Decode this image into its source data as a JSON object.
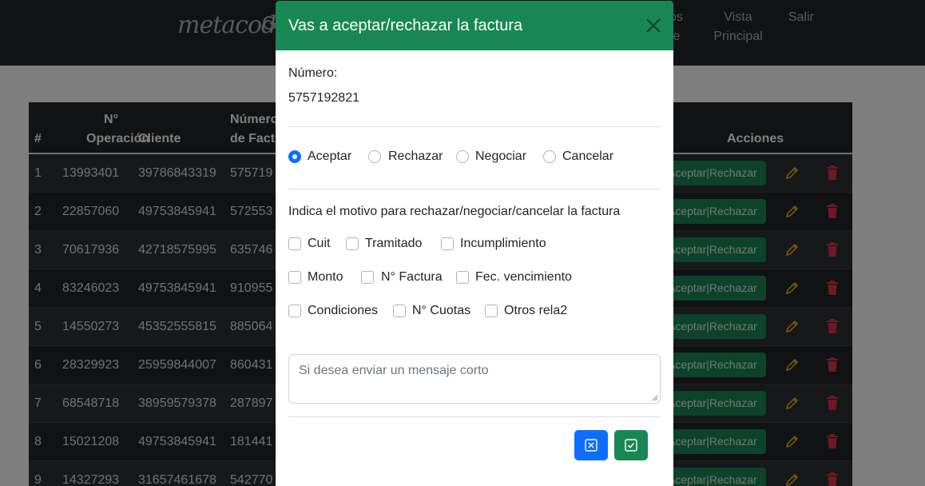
{
  "navbar": {
    "logo": "metacodo",
    "brand_rest": "G",
    "links": [
      {
        "line1": "os",
        "line2": "te"
      },
      {
        "line1": "Vista",
        "line2": "Principal"
      },
      {
        "line1": "Salir",
        "line2": ""
      }
    ]
  },
  "table": {
    "headers": {
      "num": "#",
      "operacion_1": "N°",
      "operacion_2": "Operación",
      "cliente": "Cliente",
      "factura_1": "Número",
      "factura_2": "de Fact",
      "acciones": "Acciones"
    },
    "rows": [
      {
        "n": "1",
        "op": "13993401",
        "cliente": "39786843319",
        "factura": "575719",
        "action": "Aceptar|Rechazar"
      },
      {
        "n": "2",
        "op": "22857060",
        "cliente": "49753845941",
        "factura": "572553",
        "action": "Aceptar|Rechazar"
      },
      {
        "n": "3",
        "op": "70617936",
        "cliente": "42718575995",
        "factura": "635746",
        "action": "Aceptar|Rechazar"
      },
      {
        "n": "4",
        "op": "83246023",
        "cliente": "49753845941",
        "factura": "910955",
        "action": "Aceptar|Rechazar"
      },
      {
        "n": "5",
        "op": "14550273",
        "cliente": "45352555815",
        "factura": "885064",
        "action": "Aceptar|Rechazar"
      },
      {
        "n": "6",
        "op": "28329923",
        "cliente": "25959844007",
        "factura": "860431",
        "action": "Aceptar|Rechazar"
      },
      {
        "n": "7",
        "op": "68548718",
        "cliente": "38959579378",
        "factura": "287897",
        "action": "Aceptar|Rechazar"
      },
      {
        "n": "8",
        "op": "15021208",
        "cliente": "49753845941",
        "factura": "181441",
        "action": "Aceptar|Rechazar"
      },
      {
        "n": "9",
        "op": "14327293",
        "cliente": "31657461678",
        "factura": "542770",
        "action": "Aceptar|Rechazar"
      }
    ]
  },
  "modal": {
    "title": "Vas a aceptar/rechazar la factura",
    "numero_label": "Número:",
    "numero_value": "5757192821",
    "options": [
      {
        "label": "Aceptar",
        "checked": true
      },
      {
        "label": "Rechazar",
        "checked": false
      },
      {
        "label": "Negociar",
        "checked": false
      },
      {
        "label": "Cancelar",
        "checked": false
      }
    ],
    "motivo_label": "Indica el motivo para rechazar/negociar/cancelar la factura",
    "reasons": [
      {
        "label": "Cuit"
      },
      {
        "label": "Tramitado"
      },
      {
        "label": "Incumplimiento"
      },
      {
        "label": "Monto"
      },
      {
        "label": "N° Factura"
      },
      {
        "label": "Fec. vencimiento"
      },
      {
        "label": "Condiciones"
      },
      {
        "label": "N° Cuotas"
      },
      {
        "label": "Otros rela2"
      }
    ],
    "message_placeholder": "Si desea enviar un mensaje corto",
    "message_value": ""
  },
  "colors": {
    "header_green": "#198754",
    "primary_blue": "#0d6efd",
    "edit_yellow": "#ffc107",
    "delete_red": "#dc3545"
  }
}
